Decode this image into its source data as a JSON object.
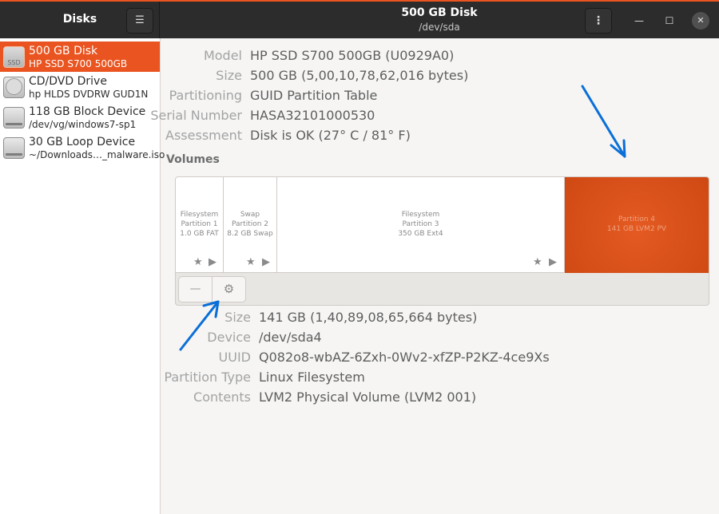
{
  "app": {
    "title": "Disks",
    "menu_icon": "hamburger-menu-icon"
  },
  "window": {
    "title": "500 GB Disk",
    "subtitle": "/dev/sda",
    "kebab_icon": "vertical-dots-menu-icon",
    "minimize_icon": "minimize-icon",
    "maximize_icon": "maximize-icon",
    "close_icon": "close-icon"
  },
  "sidebar": {
    "drives": [
      {
        "name": "500 GB Disk",
        "desc": "HP SSD S700 500GB",
        "icon": "ssd-drive-icon",
        "icon_text": "SSD",
        "selected": true
      },
      {
        "name": "CD/DVD Drive",
        "desc": "hp HLDS  DVDRW  GUD1N",
        "icon": "optical-drive-icon",
        "icon_text": "",
        "selected": false
      },
      {
        "name": "118 GB Block Device",
        "desc": "/dev/vg/windows7-sp1",
        "icon": "hard-drive-icon",
        "icon_text": "",
        "selected": false
      },
      {
        "name": "30 GB Loop Device",
        "desc": "~/Downloads…_malware.iso",
        "icon": "hard-drive-icon",
        "icon_text": "",
        "selected": false
      }
    ]
  },
  "disk_info": {
    "model_label": "Model",
    "model_value": "HP SSD S700 500GB (U0929A0)",
    "size_label": "Size",
    "size_value": "500 GB (5,00,10,78,62,016 bytes)",
    "partitioning_label": "Partitioning",
    "partitioning_value": "GUID Partition Table",
    "serial_label": "Serial Number",
    "serial_value": "HASA32101000530",
    "assessment_label": "Assessment",
    "assessment_value": "Disk is OK (27° C / 81° F)"
  },
  "volumes": {
    "title": "Volumes",
    "partitions": [
      {
        "line1": "Filesystem",
        "line2": "Partition 1",
        "line3": "1.0 GB FAT",
        "selected": false
      },
      {
        "line1": "Swap",
        "line2": "Partition 2",
        "line3": "8.2 GB Swap",
        "selected": false
      },
      {
        "line1": "Filesystem",
        "line2": "Partition 3",
        "line3": "350 GB Ext4",
        "selected": false
      },
      {
        "line1": "Partition 4",
        "line2": "141 GB LVM2 PV",
        "line3": "",
        "selected": true
      }
    ],
    "toolbar": {
      "minus_label": "—",
      "minus_icon": "minus-icon",
      "gear_icon": "gears-icon"
    }
  },
  "partition_info": {
    "size_label": "Size",
    "size_value": "141 GB (1,40,89,08,65,664 bytes)",
    "device_label": "Device",
    "device_value": "/dev/sda4",
    "uuid_label": "UUID",
    "uuid_value": "Q082o8-wbAZ-6Zxh-0Wv2-xfZP-P2KZ-4ce9Xs",
    "type_label": "Partition Type",
    "type_value": "Linux Filesystem",
    "contents_label": "Contents",
    "contents_value": "LVM2 Physical Volume (LVM2 001)"
  },
  "colors": {
    "accent": "#e95420",
    "headerbar": "#2c2c2c",
    "annotation_arrow": "#0a6fd8"
  }
}
